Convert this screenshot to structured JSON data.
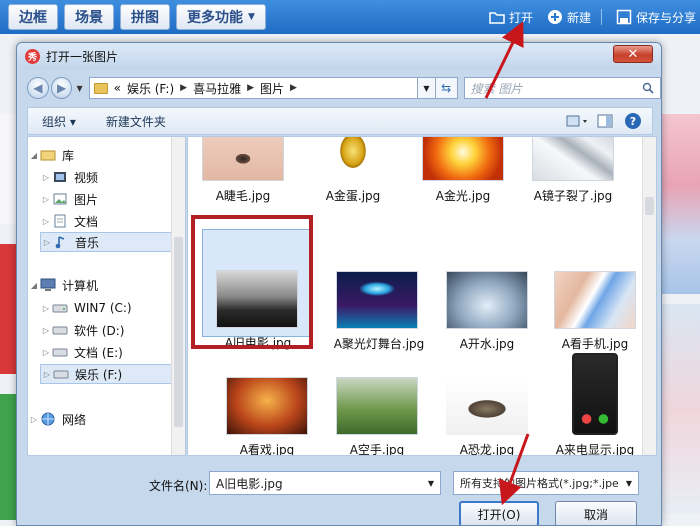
{
  "app": {
    "tabs": [
      "边框",
      "场景",
      "拼图",
      "更多功能"
    ],
    "actions": {
      "open": "打开",
      "new": "新建",
      "save": "保存与分享"
    }
  },
  "dialog": {
    "title": "打开一张图片",
    "close": "✕",
    "address": {
      "prefix": "«",
      "crumbs": [
        "娱乐 (F:)",
        "喜马拉雅",
        "图片"
      ]
    },
    "search_placeholder": "搜索 图片",
    "commands": {
      "organize": "组织 ▾",
      "new_folder": "新建文件夹"
    },
    "nav": {
      "library": "库",
      "video": "视频",
      "pictures": "图片",
      "documents": "文档",
      "music": "音乐",
      "computer": "计算机",
      "win7": "WIN7 (C:)",
      "software": "软件 (D:)",
      "docs_drive": "文档 (E:)",
      "ent_drive": "娱乐 (F:)",
      "network": "网络"
    },
    "files": [
      {
        "name": "A睫毛.jpg"
      },
      {
        "name": "A金蛋.jpg"
      },
      {
        "name": "A金光.jpg"
      },
      {
        "name": "A镜子裂了.jpg"
      },
      {
        "name": "A旧电影.jpg"
      },
      {
        "name": "A聚光灯舞台.jpg"
      },
      {
        "name": "A开水.jpg"
      },
      {
        "name": "A看手机.jpg"
      },
      {
        "name": "A看戏.jpg"
      },
      {
        "name": "A空手.jpg"
      },
      {
        "name": "A恐龙.jpg"
      },
      {
        "name": "A来电显示.jpg"
      }
    ],
    "filename_label": "文件名(N):",
    "filename_value": "A旧电影.jpg",
    "filetype_value": "所有支持的图片格式(*.jpg;*.jpe",
    "open_button": "打开(O)",
    "cancel_button": "取消"
  },
  "colors": {
    "toolbar": "#2a79d4",
    "highlight": "#b21f24",
    "close": "#c7412c"
  }
}
